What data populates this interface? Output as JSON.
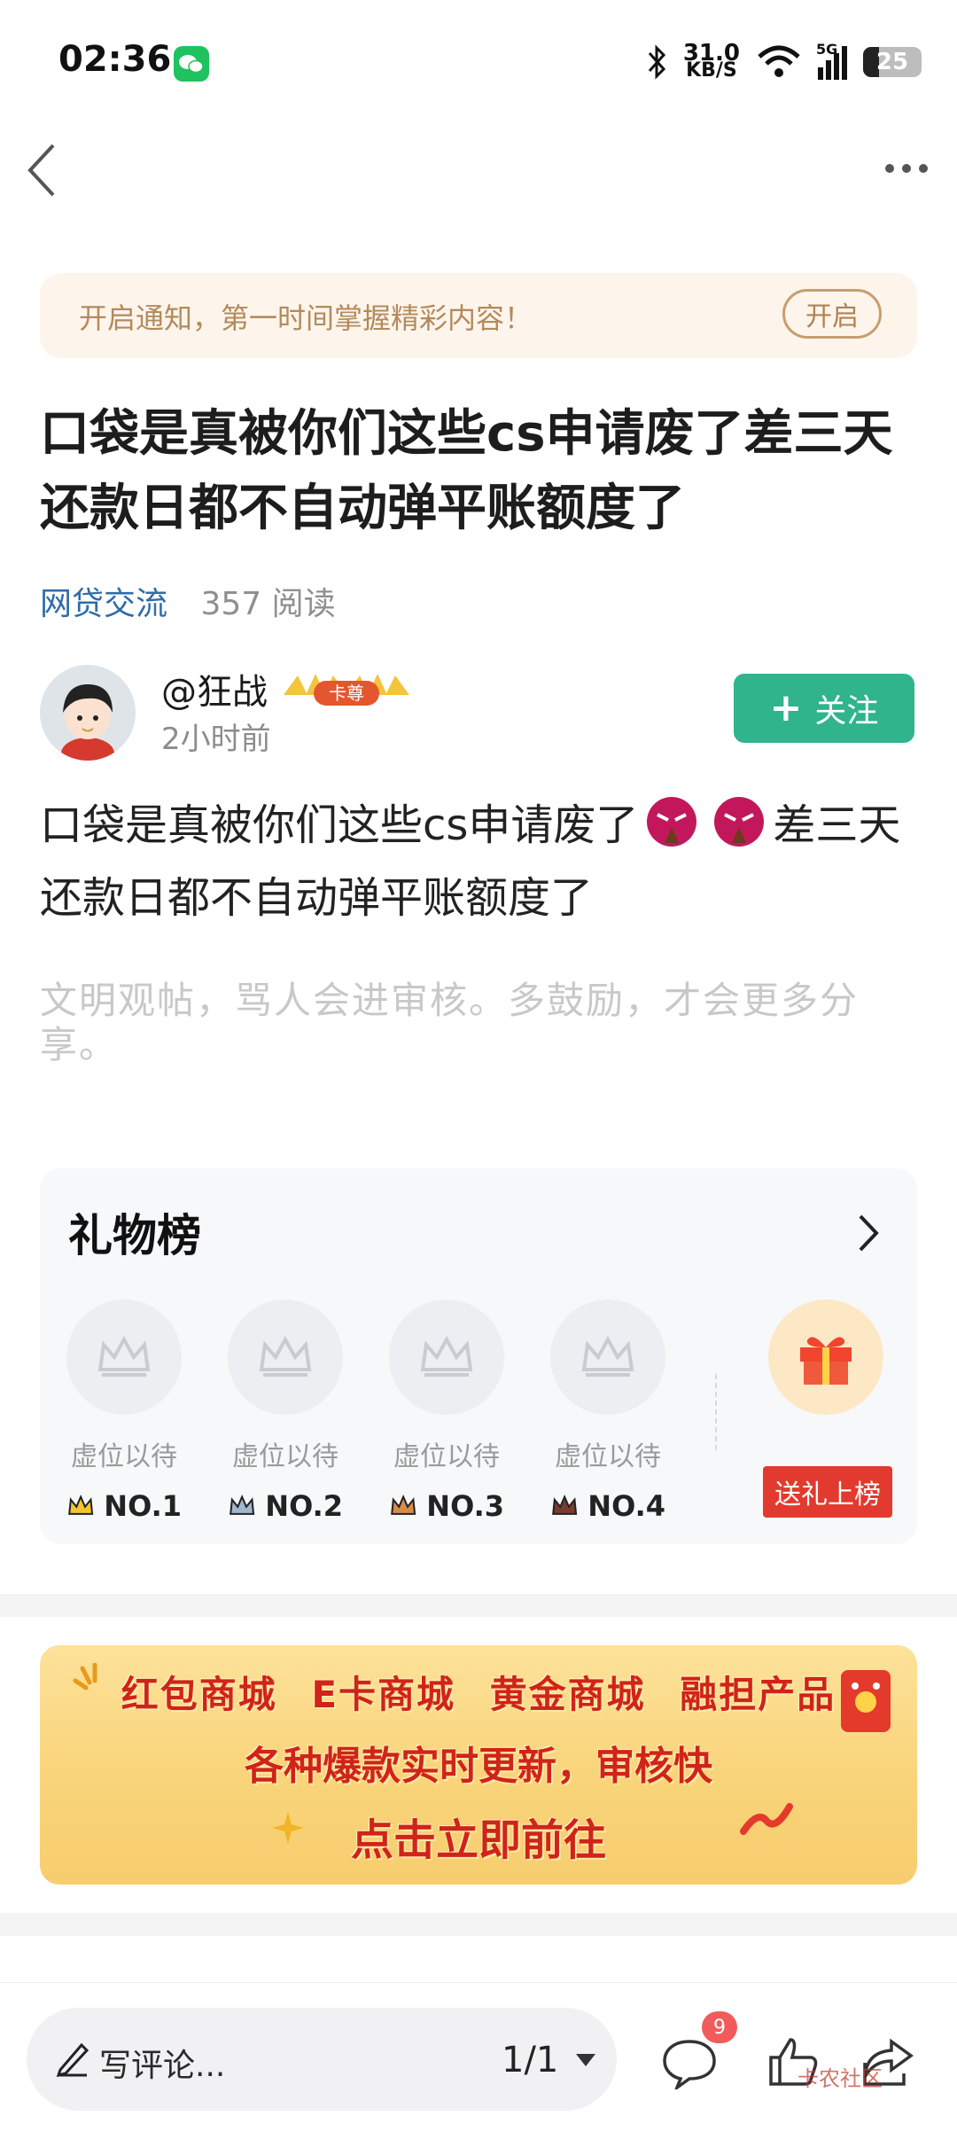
{
  "status_bar": {
    "time": "02:36",
    "net_speed_value": "31.0",
    "net_speed_unit": "KB/S",
    "signal": "5G",
    "battery": "25"
  },
  "nav": {
    "back_icon": "chevron-left-icon",
    "more_icon": "more-dots-icon"
  },
  "notify": {
    "text": "开启通知，第一时间掌握精彩内容！",
    "button": "开启"
  },
  "post": {
    "title": "口袋是真被你们这些cs申请废了差三天还款日都不自动弹平账额度了",
    "category": "网贷交流",
    "reads": "357 阅读",
    "body_part1": "口袋是真被你们这些cs申请废了",
    "body_part2": "差三天还款日都不自动弹平账额度了",
    "civility_hint": "文明观帖，骂人会进审核。多鼓励，才会更多分享。"
  },
  "author": {
    "name": "@狂战",
    "badge": "卡尊",
    "time": "2小时前",
    "follow_label": "关注",
    "follow_plus": "+"
  },
  "gift_board": {
    "title": "礼物榜",
    "slots": [
      {
        "label": "虚位以待",
        "rank": "NO.1",
        "crown_color": "#f4c430"
      },
      {
        "label": "虚位以待",
        "rank": "NO.2",
        "crown_color": "#9fb6cd"
      },
      {
        "label": "虚位以待",
        "rank": "NO.3",
        "crown_color": "#d98c4a"
      },
      {
        "label": "虚位以待",
        "rank": "NO.4",
        "crown_color": "#7a3b2e"
      }
    ],
    "send_button": "送礼上榜"
  },
  "ad": {
    "line1": "红包商城 E卡商城 黄金商城 融担产品",
    "line2": "各种爆款实时更新，审核快",
    "line3": "点击立即前往"
  },
  "bottom_bar": {
    "comment_placeholder": "写评论...",
    "page_indicator": "1/1",
    "comment_count": "9",
    "watermark": "卡农社区"
  },
  "colors": {
    "accent_green": "#2fb48c",
    "tag_blue": "#2f6ca8",
    "gift_red": "#e23a2e"
  }
}
